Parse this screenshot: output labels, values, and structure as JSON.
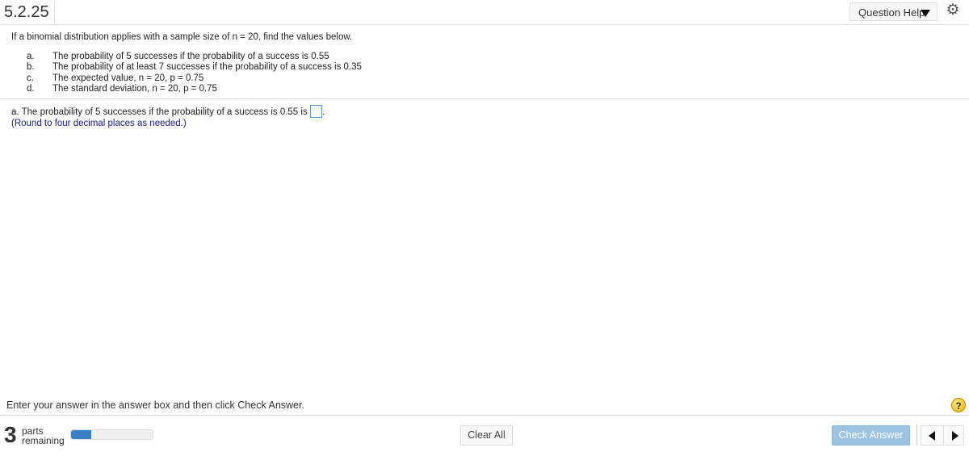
{
  "header": {
    "question_number": "5.2.25",
    "question_help_label": "Question Help",
    "settings_icon": "gear-icon"
  },
  "question": {
    "intro": "If a binomial distribution applies with a sample size of n = 20, find the values below.",
    "items": [
      {
        "label": "a.",
        "text": "The probability of 5 successes if the probability of a success is 0.55"
      },
      {
        "label": "b.",
        "text": "The probability of at least 7 successes if the probability of a success is 0.35"
      },
      {
        "label": "c.",
        "text": "The expected value, n = 20, p = 0.75"
      },
      {
        "label": "d.",
        "text": "The standard deviation, n = 20, p = 0.75"
      }
    ],
    "part_a_prompt": "a. The probability of 5 successes if the probability of a success is 0.55 is",
    "part_a_suffix": ".",
    "answer_value": "",
    "hint": "(Round to four decimal places as needed.)"
  },
  "footer": {
    "instruction": "Enter your answer in the answer box and then click Check Answer.",
    "help_icon": "?",
    "parts_remaining_count": "3",
    "parts_label": "parts",
    "remaining_label": "remaining",
    "progress_fraction": 0.25,
    "clear_all_label": "Clear All",
    "check_answer_label": "Check Answer"
  },
  "colors": {
    "progress_fill": "#3a7fc8",
    "check_answer_bg": "#9cc4e2",
    "hint_text": "#1a1a9c",
    "answer_box_border": "#5b9bd5"
  }
}
